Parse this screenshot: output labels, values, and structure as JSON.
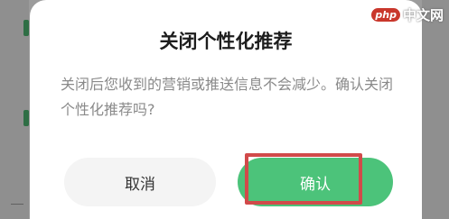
{
  "dialog": {
    "title": "关闭个性化推荐",
    "message": "关闭后您收到的营销或推送信息不会减少。确认关闭个性化推荐吗?",
    "cancel_label": "取消",
    "confirm_label": "确认"
  },
  "watermark": {
    "logo": "php",
    "text": "中文网"
  },
  "colors": {
    "confirm": "#4cc37a",
    "highlight": "#d14a4a"
  }
}
